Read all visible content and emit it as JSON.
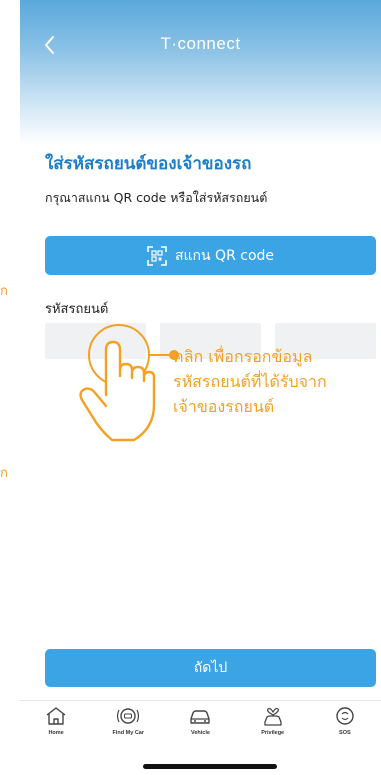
{
  "side_notes": {
    "note1": "ก",
    "note2": "ก"
  },
  "header": {
    "title": "T·connect"
  },
  "main": {
    "section_title": "ใส่รหัสรถยนต์ของเจ้าของรถ",
    "instruction": "กรุณาสแกน QR code หรือใส่รหัสรถยนต์",
    "scan_button_label": "สแกน QR code",
    "code_label": "รหัสรถยนต์",
    "hint_text": "คลิก  เพื่อกรอกข้อมูล\nรหัสรถยนต์ที่ได้รับจาก\nเจ้าของรถยนต์",
    "next_button_label": "ถัดไป"
  },
  "tabs": [
    {
      "label": "Home",
      "icon": "home-icon"
    },
    {
      "label": "Find My Car",
      "icon": "find-car-icon"
    },
    {
      "label": "Vehicle",
      "icon": "vehicle-icon"
    },
    {
      "label": "Privilege",
      "icon": "privilege-icon"
    },
    {
      "label": "SOS",
      "icon": "sos-icon"
    }
  ],
  "colors": {
    "accent": "#3aa4e4",
    "title_blue": "#1e7fc8",
    "hint_orange": "#f5a023"
  }
}
